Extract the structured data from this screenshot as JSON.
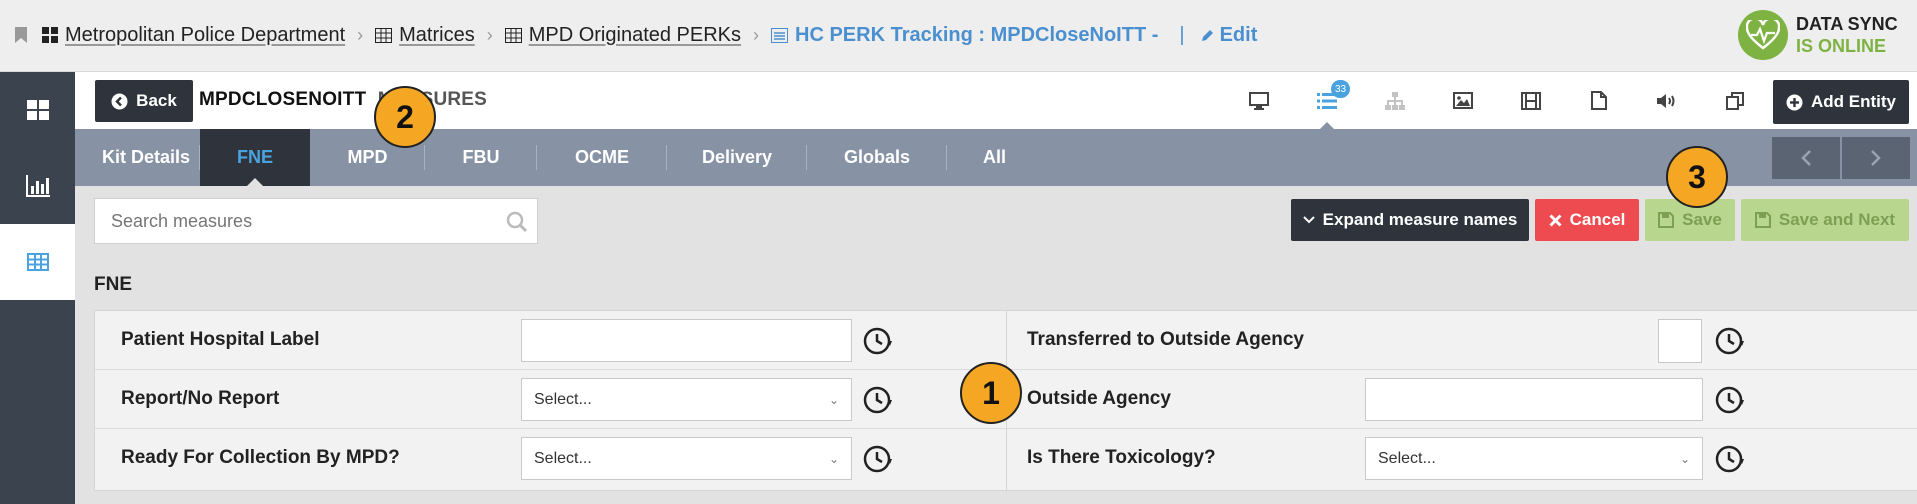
{
  "breadcrumb": {
    "items": [
      {
        "label": "Metropolitan Police Department",
        "icon": "dashboard-icon"
      },
      {
        "label": "Matrices",
        "icon": "table-icon"
      },
      {
        "label": "MPD Originated PERKs",
        "icon": "table-icon"
      }
    ],
    "current": {
      "label": "HC PERK Tracking : MPDCloseNoITT  -",
      "icon": "list-window-icon"
    },
    "edit_label": "Edit"
  },
  "sync": {
    "line1": "DATA SYNC",
    "line2": "IS ONLINE",
    "color": "#7eb343"
  },
  "header": {
    "back_label": "Back",
    "entity_title": "MPDCLOSENOITT",
    "entity_suffix": "MEASURES",
    "tools_badge": "33",
    "add_entity_label": "Add Entity"
  },
  "tabs": [
    {
      "label": "Kit Details",
      "active": false
    },
    {
      "label": "FNE",
      "active": true
    },
    {
      "label": "MPD",
      "active": false
    },
    {
      "label": "FBU",
      "active": false
    },
    {
      "label": "OCME",
      "active": false
    },
    {
      "label": "Delivery",
      "active": false
    },
    {
      "label": "Globals",
      "active": false
    },
    {
      "label": "All",
      "active": false
    }
  ],
  "toolbar": {
    "search_placeholder": "Search measures",
    "expand_label": "Expand measure names",
    "cancel_label": "Cancel",
    "save_label": "Save",
    "save_next_label": "Save and Next"
  },
  "section": {
    "title": "FNE",
    "left": [
      {
        "label": "Patient Hospital Label",
        "type": "text",
        "value": ""
      },
      {
        "label": "Report/No Report",
        "type": "select",
        "value": "Select..."
      },
      {
        "label": "Ready For Collection By MPD?",
        "type": "select",
        "value": "Select..."
      }
    ],
    "right": [
      {
        "label": "Transferred to Outside Agency",
        "type": "checkbox",
        "value": ""
      },
      {
        "label": "Outside Agency",
        "type": "text",
        "value": ""
      },
      {
        "label": "Is There Toxicology?",
        "type": "select",
        "value": "Select..."
      }
    ]
  },
  "callouts": [
    "1",
    "2",
    "3"
  ],
  "colors": {
    "accent": "#4aa3df",
    "dark": "#2f343c",
    "danger": "#ed4b4f",
    "success_muted": "#b9d68f",
    "callout": "#f5a623",
    "tabbar": "#8793a4"
  }
}
